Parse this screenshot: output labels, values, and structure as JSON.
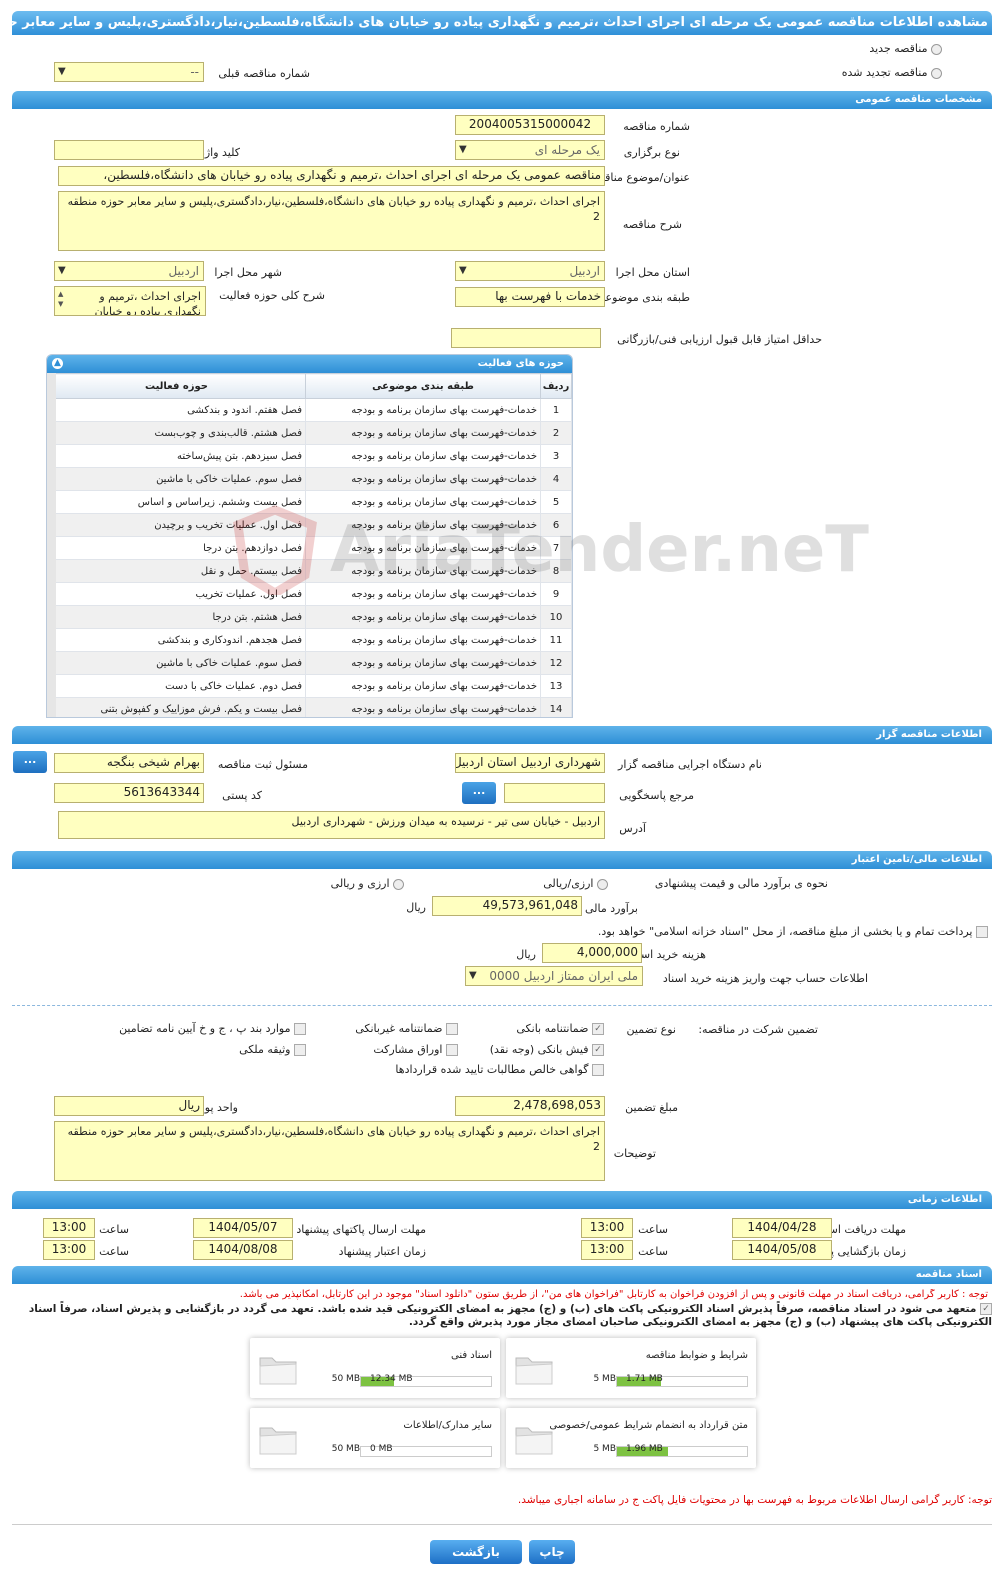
{
  "title": "مشاهده اطلاعات مناقصه عمومی یک مرحله ای اجرای احداث ،ترمیم و نگهداری پیاده رو خیابان های دانشگاه،فلسطین،نیار،دادگستری،پلیس و سایر معابر حوزه منطقه 2",
  "top": {
    "new_tender": "مناقصه جدید",
    "renewed_tender": "مناقصه تجدید شده",
    "prev_number_label": "شماره مناقصه قبلی",
    "prev_number_value": "--"
  },
  "general": {
    "header": "مشخصات مناقصه عمومی",
    "number_label": "شماره مناقصه",
    "number_value": "2004005315000042",
    "type_label": "نوع برگزاری",
    "type_value": "یک مرحله ای",
    "keyword_label": "کلید واژه",
    "subject_label": "عنوان/موضوع مناقصه",
    "subject_value": "مناقصه عمومی یک مرحله ای اجرای احداث ،ترمیم و نگهداری پیاده رو خیابان های دانشگاه،فلسطین،",
    "desc_label": "شرح مناقصه",
    "desc_value": "اجرای احداث ،ترمیم و نگهداری پیاده رو خیابان های دانشگاه،فلسطین،نیار،دادگستری،پلیس و سایر معابر حوزه منطقه 2",
    "province_label": "استان محل اجرا",
    "province_value": "اردبیل",
    "city_label": "شهر محل اجرا",
    "city_value": "اردبیل",
    "category_label": "طبقه بندی موضوعی",
    "category_value": "خدمات با فهرست بها",
    "scope_label": "شرح کلی حوزه فعالیت",
    "scope_value": "اجرای احداث ،ترمیم و نگهداری پیاده رو خیابان",
    "min_score_label": "حداقل امتیاز قابل قبول ارزیابی فنی/بازرگانی"
  },
  "activities": {
    "header": "حوزه های فعالیت",
    "col_row": "ردیف",
    "col_category": "طبقه بندی موضوعی",
    "col_scope": "حوزه فعالیت",
    "rows": [
      {
        "n": "1",
        "cat": "خدمات-فهرست بهای سازمان برنامه و بودجه",
        "scope": "فصل هفتم. اندود و بندکشی"
      },
      {
        "n": "2",
        "cat": "خدمات-فهرست بهای سازمان برنامه و بودجه",
        "scope": "فصل هشتم. قالب‌بندی و چوب‌بست"
      },
      {
        "n": "3",
        "cat": "خدمات-فهرست بهای سازمان برنامه و بودجه",
        "scope": "فصل سیزدهم. بتن پیش‌ساخته"
      },
      {
        "n": "4",
        "cat": "خدمات-فهرست بهای سازمان برنامه و بودجه",
        "scope": "فصل سوم. عملیات خاکی با ماشین"
      },
      {
        "n": "5",
        "cat": "خدمات-فهرست بهای سازمان برنامه و بودجه",
        "scope": "فصل بیست وششم. زیراساس و اساس"
      },
      {
        "n": "6",
        "cat": "خدمات-فهرست بهای سازمان برنامه و بودجه",
        "scope": "فصل اول. عملیات تخریب و برچیدن"
      },
      {
        "n": "7",
        "cat": "خدمات-فهرست بهای سازمان برنامه و بودجه",
        "scope": "فصل دوازدهم. بتن درجا"
      },
      {
        "n": "8",
        "cat": "خدمات-فهرست بهای سازمان برنامه و بودجه",
        "scope": "فصل بیستم. حمل و نقل"
      },
      {
        "n": "9",
        "cat": "خدمات-فهرست بهای سازمان برنامه و بودجه",
        "scope": "فصل اول. عملیات تخریب"
      },
      {
        "n": "10",
        "cat": "خدمات-فهرست بهای سازمان برنامه و بودجه",
        "scope": "فصل هشتم. بتن درجا"
      },
      {
        "n": "11",
        "cat": "خدمات-فهرست بهای سازمان برنامه و بودجه",
        "scope": "فصل هجدهم. اندودکاری و بندکشی"
      },
      {
        "n": "12",
        "cat": "خدمات-فهرست بهای سازمان برنامه و بودجه",
        "scope": "فصل سوم. عملیات خاکی با ماشین"
      },
      {
        "n": "13",
        "cat": "خدمات-فهرست بهای سازمان برنامه و بودجه",
        "scope": "فصل دوم. عملیات خاکی با دست"
      },
      {
        "n": "14",
        "cat": "خدمات-فهرست بهای سازمان برنامه و بودجه",
        "scope": "فصل بیست و یکم. فرش موزاییک و کفپوش بتنی"
      }
    ]
  },
  "organizer": {
    "header": "اطلاعات مناقصه گزار",
    "org_label": "نام دستگاه اجرایی مناقصه گزار",
    "org_value": "شهرداری اردبیل استان اردبیل",
    "resp_label": "مسئول ثبت مناقصه",
    "resp_value": "بهرام شیخی بنگجه",
    "ref_label": "مرجع پاسخگویی",
    "postal_label": "کد پستی",
    "postal_value": "5613643344",
    "address_label": "آدرس",
    "address_value": "اردبیل - خیابان سی تیر - نرسیده به میدان ورزش - شهرداری اردبیل",
    "more": "..."
  },
  "finance": {
    "header": "اطلاعات مالی/تامین اعتبار",
    "method_label": "نحوه ی برآورد مالی و قیمت پیشنهادی",
    "opt_rial": "ارزی/ریالی",
    "opt_both": "ارزی و ریالی",
    "estimate_label": "برآورد مالی",
    "estimate_value": "49,573,961,048",
    "rial": "ریال",
    "treasury_text": "پرداخت تمام و یا بخشی از مبلغ مناقصه، از محل \"اسناد خزانه اسلامی\" خواهد بود.",
    "doc_fee_label": "هزینه خرید اسناد",
    "doc_fee_value": "4,000,000",
    "account_label": "اطلاعات حساب جهت واریز هزینه خرید اسناد",
    "account_value": "ملی ایران ممتاز اردبیل 0000",
    "guarantee_label": "تضمین شرکت در مناقصه:",
    "guarantee_type_label": "نوع تضمین",
    "g_bank": "ضمانتنامه بانکی",
    "g_nonbank": "ضمانتنامه غیربانکی",
    "g_clauses": "موارد بند پ ، ج و خ آیین نامه تضامین",
    "g_cash": "فیش بانکی (وجه نقد)",
    "g_bonds": "اوراق مشارکت",
    "g_property": "وثیقه ملکی",
    "g_claims": "گواهی خالص مطالبات تایید شده قراردادها",
    "amount_label": "مبلغ تضمین",
    "amount_value": "2,478,698,053",
    "currency_label": "واحد پول",
    "currency_value": "ریال",
    "notes_label": "توضیحات",
    "notes_value": "اجرای احداث ،ترمیم و نگهداری پیاده رو خیابان های دانشگاه،فلسطین،نیار،دادگستری،پلیس و سایر معابر حوزه منطقه 2"
  },
  "timing": {
    "header": "اطلاعات زمانی",
    "doc_receive_label": "مهلت دریافت اسناد",
    "doc_receive_date": "1404/04/28",
    "doc_receive_time": "13:00",
    "submit_label": "مهلت ارسال پاکتهای پیشنهاد",
    "submit_date": "1404/05/07",
    "submit_time": "13:00",
    "open_label": "زمان بازگشایی پاکت ها",
    "open_date": "1404/05/08",
    "open_time": "13:00",
    "valid_label": "زمان اعتبار پیشنهاد",
    "valid_date": "1404/08/08",
    "valid_time": "13:00",
    "time_label": "ساعت"
  },
  "docs": {
    "header": "اسناد مناقصه",
    "notice": "توجه : کاربر گرامی، دریافت اسناد در مهلت قانونی و پس از افزودن فراخوان به کارتابل \"فراخوان های من\"، از طریق ستون \"دانلود اسناد\" موجود در این کارتابل، امکانپذیر می باشد.",
    "commit": "متعهد می شود در اسناد مناقصه، صرفاً پذیرش اسناد الکترونیکی پاکت های (ب) و (ج) مجهز به امضای الکترونیکی قید شده باشد. تعهد می گردد در بازگشایی و پذیرش اسناد، صرفاً اسناد الکترونیکی پاکت های پیشنهاد (ب) و (ج) مجهز به امضای الکترونیکی صاحبان امضای مجاز مورد پذیرش واقع گردد.",
    "files": [
      {
        "title": "شرایط و ضوابط مناقصه",
        "max": "5 MB",
        "size": "1.71 MB",
        "pct": 34
      },
      {
        "title": "اسناد فنی",
        "max": "50 MB",
        "size": "12.34 MB",
        "pct": 25
      },
      {
        "title": "متن قرارداد به انضمام شرایط عمومی/خصوصی",
        "max": "5 MB",
        "size": "1.96 MB",
        "pct": 39
      },
      {
        "title": "سایر مدارک/اطلاعات",
        "max": "50 MB",
        "size": "0 MB",
        "pct": 0
      }
    ],
    "footer_note": "توجه: کاربر گرامی ارسال اطلاعات مربوط به فهرست بها در محتویات فایل پاکت ج در سامانه اجباری میباشد."
  },
  "buttons": {
    "print": "چاپ",
    "back": "بازگشت"
  },
  "watermark": "AriaTender.neT"
}
